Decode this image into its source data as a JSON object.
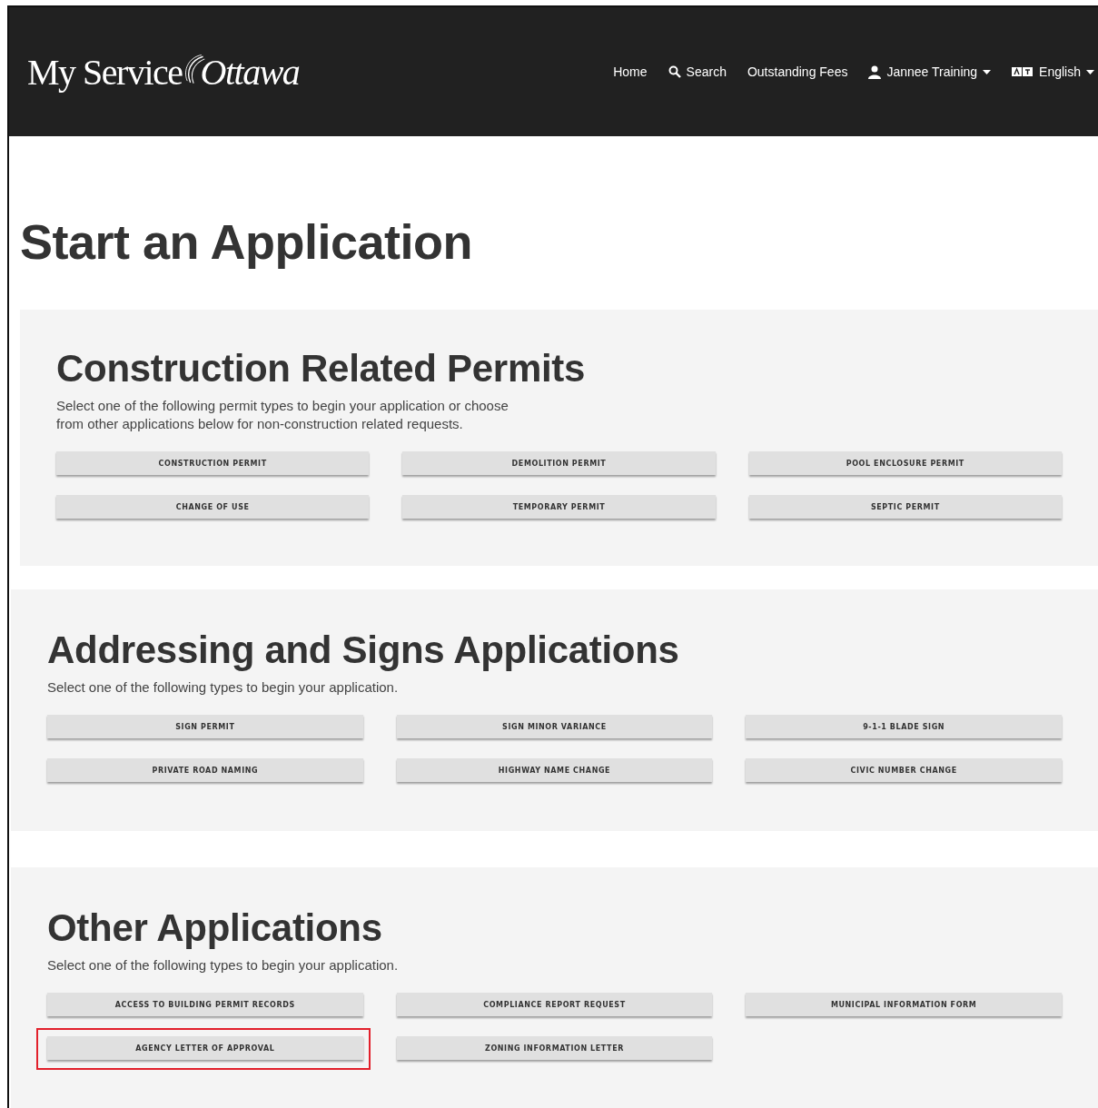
{
  "header": {
    "logo": {
      "part_1": "My Service",
      "part_2": "Ottawa"
    },
    "nav": [
      {
        "label": "Home",
        "kind": "plain",
        "dropdown": false
      },
      {
        "label": "Search",
        "kind": "search",
        "dropdown": false
      },
      {
        "label": "Outstanding Fees",
        "kind": "plain",
        "dropdown": false
      },
      {
        "label": "Jannee Training",
        "kind": "account",
        "dropdown": true
      },
      {
        "label": "English",
        "kind": "language",
        "dropdown": true
      }
    ]
  },
  "page_title": "Start an Application",
  "sections": [
    {
      "title": "Construction Related Permits",
      "description": "Select one of the following permit types to begin your application or choose\nfrom other applications below for non-construction related requests.",
      "buttons": [
        {
          "label": "CONSTRUCTION PERMIT",
          "highlighted": false
        },
        {
          "label": "DEMOLITION PERMIT",
          "highlighted": false
        },
        {
          "label": "POOL ENCLOSURE PERMIT",
          "highlighted": false
        },
        {
          "label": "CHANGE OF USE",
          "highlighted": false
        },
        {
          "label": "TEMPORARY PERMIT",
          "highlighted": false
        },
        {
          "label": "SEPTIC PERMIT",
          "highlighted": false
        }
      ]
    },
    {
      "title": "Addressing and Signs Applications",
      "description": "Select one of the following types to begin your application.",
      "buttons": [
        {
          "label": "SIGN PERMIT",
          "highlighted": false
        },
        {
          "label": "SIGN MINOR VARIANCE",
          "highlighted": false
        },
        {
          "label": "9-1-1 BLADE SIGN",
          "highlighted": false
        },
        {
          "label": "PRIVATE ROAD NAMING",
          "highlighted": false
        },
        {
          "label": "HIGHWAY NAME CHANGE",
          "highlighted": false
        },
        {
          "label": "CIVIC NUMBER CHANGE",
          "highlighted": false
        }
      ]
    },
    {
      "title": "Other Applications",
      "description": "Select one of the following types to begin your application.",
      "buttons": [
        {
          "label": "ACCESS TO BUILDING PERMIT RECORDS",
          "highlighted": false
        },
        {
          "label": "COMPLIANCE REPORT REQUEST",
          "highlighted": false
        },
        {
          "label": "MUNICIPAL INFORMATION FORM",
          "highlighted": false
        },
        {
          "label": "AGENCY LETTER OF APPROVAL",
          "highlighted": true
        },
        {
          "label": "ZONING INFORMATION LETTER",
          "highlighted": false
        }
      ]
    }
  ]
}
